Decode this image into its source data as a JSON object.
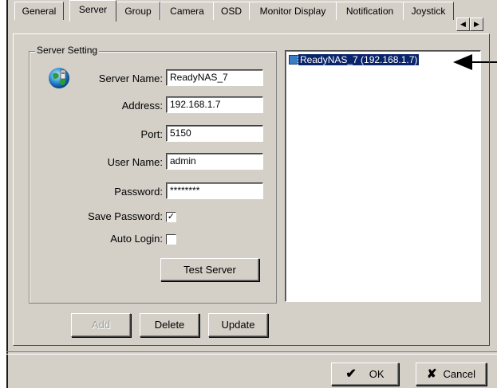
{
  "tabs": [
    {
      "label": "General",
      "active": false
    },
    {
      "label": "Server",
      "active": true
    },
    {
      "label": "Group",
      "active": false
    },
    {
      "label": "Camera",
      "active": false
    },
    {
      "label": "OSD",
      "active": false
    },
    {
      "label": "Monitor Display",
      "active": false
    },
    {
      "label": "Notification",
      "active": false
    },
    {
      "label": "Joystick",
      "active": false
    }
  ],
  "server_setting": {
    "group_title": "Server Setting",
    "icon": "server-globe-icon",
    "server_name_label": "Server Name:",
    "server_name_value": "ReadyNAS_7",
    "address_label": "Address:",
    "address_value": "192.168.1.7",
    "port_label": "Port:",
    "port_value": "5150",
    "user_name_label": "User Name:",
    "user_name_value": "admin",
    "password_label": "Password:",
    "password_value": "********",
    "save_password_label": "Save Password:",
    "save_password_checked": true,
    "auto_login_label": "Auto Login:",
    "auto_login_checked": false,
    "test_server_label": "Test Server"
  },
  "actions": {
    "add_label": "Add",
    "delete_label": "Delete",
    "update_label": "Update"
  },
  "server_list": {
    "items": [
      {
        "label": "ReadyNAS_7 (192.168.1.7)",
        "selected": true,
        "icon": "server-node-icon"
      }
    ]
  },
  "footer": {
    "ok_label": "OK",
    "cancel_label": "Cancel"
  },
  "annotation": {
    "icon": "pointer-arrow"
  },
  "colors": {
    "dialog_bg": "#d4d0c8",
    "selection": "#0a246a",
    "arrow": "#000000"
  }
}
